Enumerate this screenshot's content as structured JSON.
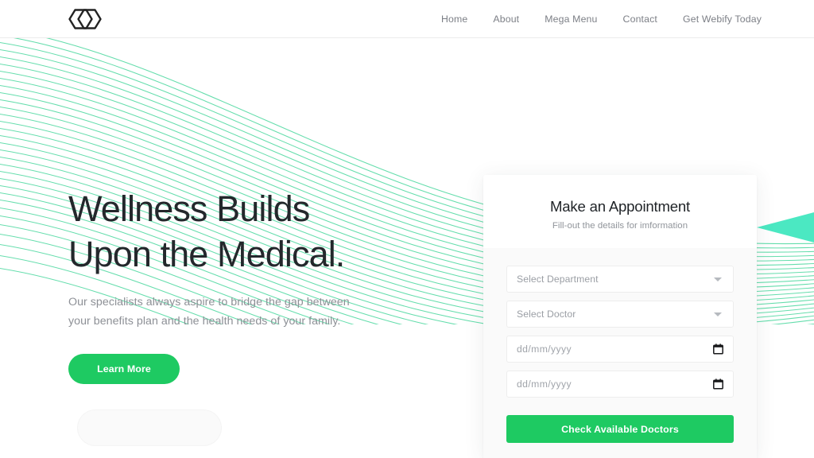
{
  "header": {
    "logo_icon": "hexagon-pair-logo",
    "nav": [
      {
        "label": "Home"
      },
      {
        "label": "About"
      },
      {
        "label": "Mega Menu"
      },
      {
        "label": "Contact"
      },
      {
        "label": "Get Webify Today"
      }
    ]
  },
  "hero": {
    "title": "Wellness Builds\nUpon the Medical.",
    "subtitle": "Our specialists always aspire to bridge the gap between\nyour benefits plan and the health needs of your family.",
    "cta_label": "Learn More"
  },
  "appointment": {
    "title": "Make an Appointment",
    "subtitle": "Fill-out the details for imformation",
    "fields": [
      {
        "type": "select",
        "value": "Select Department",
        "icon": "chevron-down-icon"
      },
      {
        "type": "select",
        "value": "Select Doctor",
        "icon": "chevron-down-icon"
      },
      {
        "type": "date",
        "value": "dd/mm/yyyy",
        "icon": "calendar-icon"
      },
      {
        "type": "date",
        "value": "dd/mm/yyyy",
        "icon": "calendar-icon"
      }
    ],
    "submit_label": "Check Available Doctors"
  },
  "decor": {
    "wave_icon": "wave-lines-graphic",
    "arrow_icon": "left-pointing-triangle-icon",
    "pill_icon": "decorative-pill-shape"
  },
  "colors": {
    "accent_green": "#1ECA62",
    "mint": "#4EE7C0",
    "wave_line": "#56D9A3",
    "heading": "#24282c",
    "body_text": "#8d9096",
    "nav_text": "#7c7f86",
    "card_body_bg": "#fafafa"
  }
}
